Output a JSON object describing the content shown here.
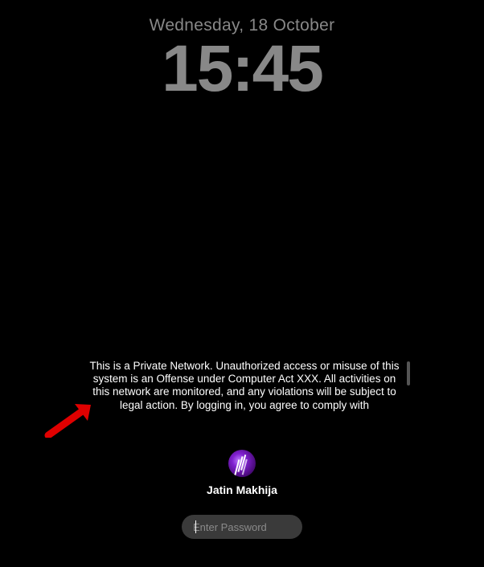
{
  "date": "Wednesday, 18 October",
  "time": "15:45",
  "policy_message": "This is a Private Network. Unauthorized access or misuse of this system is an Offense under Computer Act XXX. All activities on this network are monitored, and any violations will be subject to legal action. By logging in, you agree to comply with",
  "username": "Jatin Makhija",
  "password_placeholder": "Enter Password",
  "password_value": ""
}
